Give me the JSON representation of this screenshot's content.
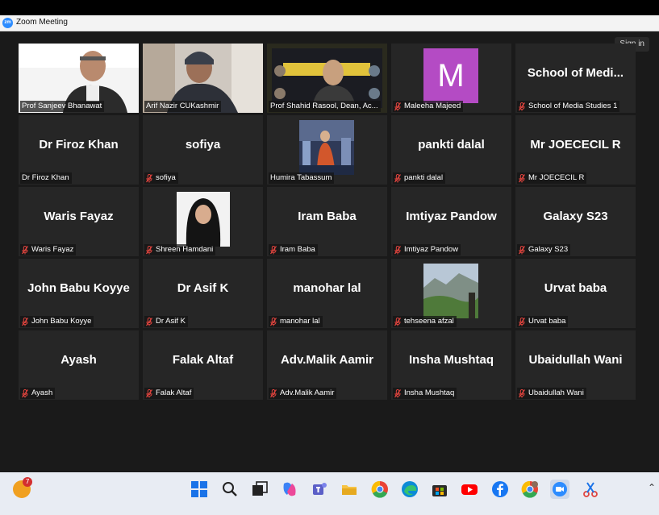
{
  "window": {
    "title": "Zoom Meeting",
    "logo_text": "zm"
  },
  "meeting": {
    "signin_label": "Sign in"
  },
  "tiles": [
    {
      "display": "",
      "label": "Prof Sanjeev Bhanawat",
      "muted": false,
      "type": "video"
    },
    {
      "display": "",
      "label": "Arif Nazir CUKashmir",
      "muted": false,
      "type": "video"
    },
    {
      "display": "",
      "label": "Prof Shahid Rasool, Dean, Ac...",
      "muted": false,
      "type": "video",
      "active": true
    },
    {
      "display": "M",
      "label": "Maleeha Majeed",
      "muted": true,
      "type": "avatar"
    },
    {
      "display": "School of Medi...",
      "label": "School of Media Studies 1",
      "muted": true,
      "type": "name"
    },
    {
      "display": "Dr Firoz Khan",
      "label": "Dr Firoz Khan",
      "muted": false,
      "type": "name"
    },
    {
      "display": "sofiya",
      "label": "sofiya",
      "muted": true,
      "type": "name"
    },
    {
      "display": "",
      "label": "Humira Tabassum",
      "muted": false,
      "type": "picture"
    },
    {
      "display": "pankti dalal",
      "label": "pankti dalal",
      "muted": true,
      "type": "name"
    },
    {
      "display": "Mr JOECECIL R",
      "label": "Mr JOECECIL R",
      "muted": true,
      "type": "name"
    },
    {
      "display": "Waris Fayaz",
      "label": "Waris Fayaz",
      "muted": true,
      "type": "name"
    },
    {
      "display": "",
      "label": "Shreen Hamdani",
      "muted": true,
      "type": "picture"
    },
    {
      "display": "Iram Baba",
      "label": "Iram Baba",
      "muted": true,
      "type": "name"
    },
    {
      "display": "Imtiyaz Pandow",
      "label": "Imtiyaz Pandow",
      "muted": true,
      "type": "name"
    },
    {
      "display": "Galaxy S23",
      "label": "Galaxy S23",
      "muted": true,
      "type": "name"
    },
    {
      "display": "John Babu Koyye",
      "label": "John Babu Koyye",
      "muted": true,
      "type": "name"
    },
    {
      "display": "Dr Asif K",
      "label": "Dr Asif K",
      "muted": true,
      "type": "name"
    },
    {
      "display": "manohar lal",
      "label": "manohar lal",
      "muted": true,
      "type": "name"
    },
    {
      "display": "",
      "label": "tehseena afzal",
      "muted": true,
      "type": "picture"
    },
    {
      "display": "Urvat baba",
      "label": "Urvat baba",
      "muted": true,
      "type": "name"
    },
    {
      "display": "Ayash",
      "label": "Ayash",
      "muted": true,
      "type": "name"
    },
    {
      "display": "Falak Altaf",
      "label": "Falak Altaf",
      "muted": true,
      "type": "name"
    },
    {
      "display": "Adv.Malik Aamir",
      "label": "Adv.Malik Aamir",
      "muted": true,
      "type": "name"
    },
    {
      "display": "Insha Mushtaq",
      "label": "Insha Mushtaq",
      "muted": true,
      "type": "name"
    },
    {
      "display": "Ubaidullah Wani",
      "label": "Ubaidullah Wani",
      "muted": true,
      "type": "name"
    }
  ],
  "taskbar": {
    "notification_count": "7",
    "icons": [
      "weather-icon",
      "windows-start-icon",
      "search-icon",
      "task-view-icon",
      "copilot-icon",
      "teams-icon",
      "file-explorer-icon",
      "chrome-icon",
      "edge-icon",
      "store-icon",
      "youtube-icon",
      "facebook-icon",
      "chrome-profile-icon",
      "zoom-icon",
      "snipping-tool-icon"
    ]
  },
  "colors": {
    "active_speaker": "#c6db3e",
    "avatar_bg": "#b44bc4",
    "muted_icon": "#e0443e"
  }
}
